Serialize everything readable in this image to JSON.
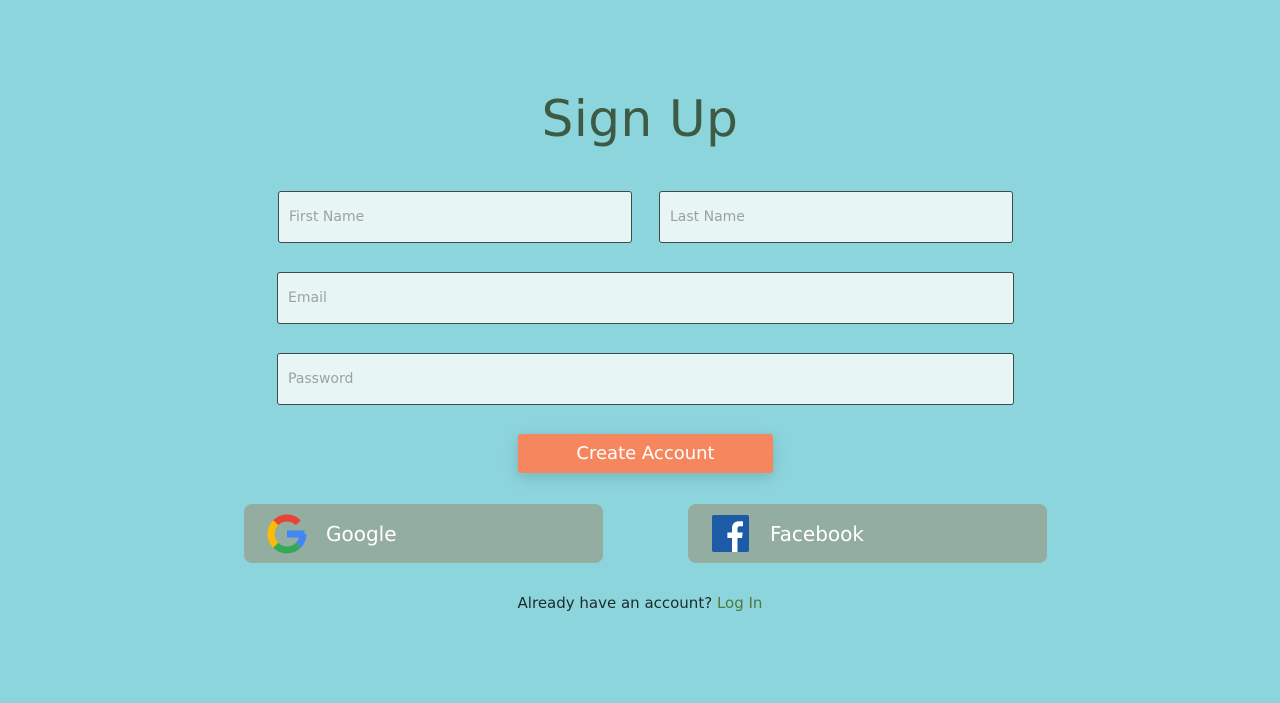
{
  "page": {
    "title": "Sign Up"
  },
  "form": {
    "first_name": {
      "placeholder": "First Name",
      "value": ""
    },
    "last_name": {
      "placeholder": "Last Name",
      "value": ""
    },
    "email": {
      "placeholder": "Email",
      "value": ""
    },
    "password": {
      "placeholder": "Password",
      "value": ""
    },
    "submit_label": "Create Account"
  },
  "social": {
    "google_label": "Google",
    "google_icon": "google-g-icon",
    "facebook_label": "Facebook",
    "facebook_icon": "facebook-f-icon"
  },
  "footer": {
    "prompt": "Already have an account?",
    "link_label": "Log In"
  },
  "colors": {
    "background": "#8dd5dd",
    "title": "#3d5a45",
    "field_bg": "#e8f5f5",
    "primary_button": "#f6865e",
    "social_button": "#93ada0",
    "link": "#4e7a3a",
    "facebook_blue": "#1d5ba6"
  }
}
